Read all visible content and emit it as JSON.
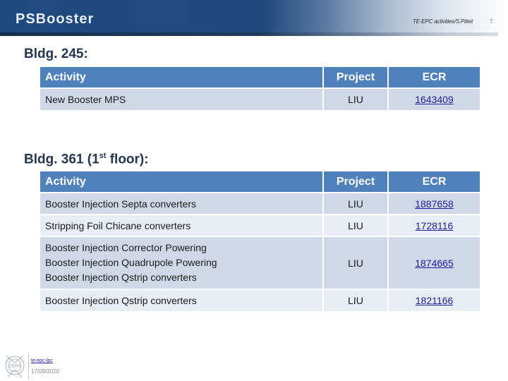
{
  "header": {
    "title": "PSBooster",
    "meta": "TE-EPC activities/S.Pittet",
    "page_number": "7"
  },
  "sections": [
    {
      "title": "Bldg. 245:",
      "table": {
        "columns": [
          "Activity",
          "Project",
          "ECR"
        ],
        "rows": [
          {
            "activity": [
              "New Booster MPS"
            ],
            "project": "LIU",
            "ecr": "1643409"
          }
        ]
      }
    },
    {
      "title_pre": "Bldg. 361 (1",
      "title_sup": "st",
      "title_post": " floor):",
      "table": {
        "columns": [
          "Activity",
          "Project",
          "ECR"
        ],
        "rows": [
          {
            "activity": [
              "Booster Injection Septa converters"
            ],
            "project": "LIU",
            "ecr": "1887658"
          },
          {
            "activity": [
              "Stripping Foil Chicane converters"
            ],
            "project": "LIU",
            "ecr": "1728116"
          },
          {
            "activity": [
              "Booster Injection Corrector Powering",
              "Booster Injection Quadrupole Powering",
              "Booster Injection Qstrip converters"
            ],
            "project": "LIU",
            "ecr": "1874665"
          },
          {
            "activity": [
              "Booster Injection Qstrip converters"
            ],
            "project": "LIU",
            "ecr": "1821166"
          }
        ]
      }
    }
  ],
  "footer": {
    "logo_icon": "cern-logo-icon",
    "logo_text": "CERN",
    "link": "te-epc-lpc",
    "date": "17/09/2020"
  },
  "colors": {
    "header_blue": "#1f4a80",
    "table_header": "#4f81bd",
    "row_odd": "#d0d8e8",
    "row_even": "#e9edf4",
    "link": "#1c1c9c"
  }
}
